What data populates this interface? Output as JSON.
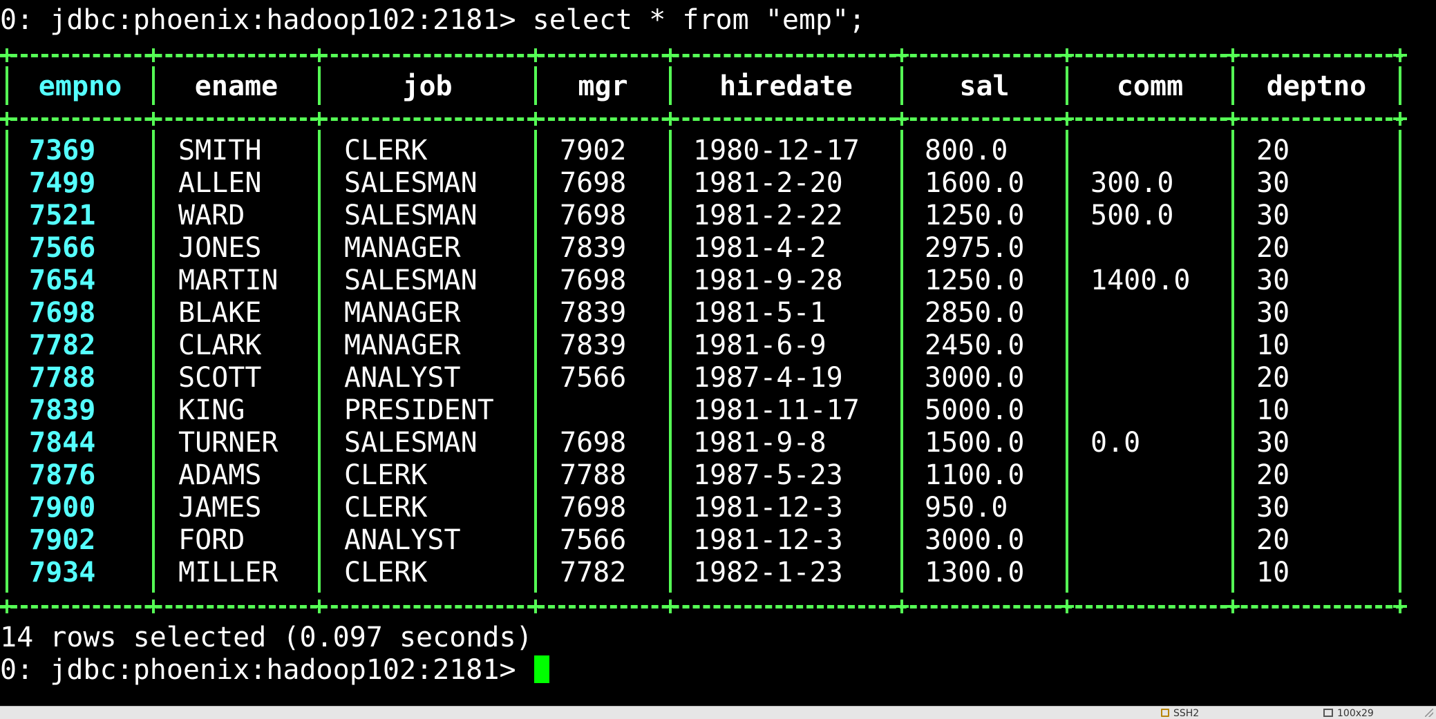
{
  "terminal": {
    "query_prompt": "0: jdbc:phoenix:hadoop102:2181> ",
    "query_command": "select * from \"emp\";",
    "result_summary": "14 rows selected (0.097 seconds)",
    "current_prompt": "0: jdbc:phoenix:hadoop102:2181> "
  },
  "table": {
    "columns": [
      "empno",
      "ename",
      "job",
      "mgr",
      "hiredate",
      "sal",
      "comm",
      "deptno"
    ],
    "rows": [
      [
        "7369",
        "SMITH",
        "CLERK",
        "7902",
        "1980-12-17",
        "800.0",
        "",
        "20"
      ],
      [
        "7499",
        "ALLEN",
        "SALESMAN",
        "7698",
        "1981-2-20",
        "1600.0",
        "300.0",
        "30"
      ],
      [
        "7521",
        "WARD",
        "SALESMAN",
        "7698",
        "1981-2-22",
        "1250.0",
        "500.0",
        "30"
      ],
      [
        "7566",
        "JONES",
        "MANAGER",
        "7839",
        "1981-4-2",
        "2975.0",
        "",
        "20"
      ],
      [
        "7654",
        "MARTIN",
        "SALESMAN",
        "7698",
        "1981-9-28",
        "1250.0",
        "1400.0",
        "30"
      ],
      [
        "7698",
        "BLAKE",
        "MANAGER",
        "7839",
        "1981-5-1",
        "2850.0",
        "",
        "30"
      ],
      [
        "7782",
        "CLARK",
        "MANAGER",
        "7839",
        "1981-6-9",
        "2450.0",
        "",
        "10"
      ],
      [
        "7788",
        "SCOTT",
        "ANALYST",
        "7566",
        "1987-4-19",
        "3000.0",
        "",
        "20"
      ],
      [
        "7839",
        "KING",
        "PRESIDENT",
        "",
        "1981-11-17",
        "5000.0",
        "",
        "10"
      ],
      [
        "7844",
        "TURNER",
        "SALESMAN",
        "7698",
        "1981-9-8",
        "1500.0",
        "0.0",
        "30"
      ],
      [
        "7876",
        "ADAMS",
        "CLERK",
        "7788",
        "1987-5-23",
        "1100.0",
        "",
        "20"
      ],
      [
        "7900",
        "JAMES",
        "CLERK",
        "7698",
        "1981-12-3",
        "950.0",
        "",
        "30"
      ],
      [
        "7902",
        "FORD",
        "ANALYST",
        "7566",
        "1981-12-3",
        "3000.0",
        "",
        "20"
      ],
      [
        "7934",
        "MILLER",
        "CLERK",
        "7782",
        "1982-1-23",
        "1300.0",
        "",
        "10"
      ]
    ]
  },
  "statusbar": {
    "connection": "SSH2",
    "size": "100x29"
  },
  "colors": {
    "background": "#000000",
    "border": "#55ff55",
    "key_column": "#55ffff",
    "text": "#ffffff",
    "cursor": "#00ff00"
  }
}
